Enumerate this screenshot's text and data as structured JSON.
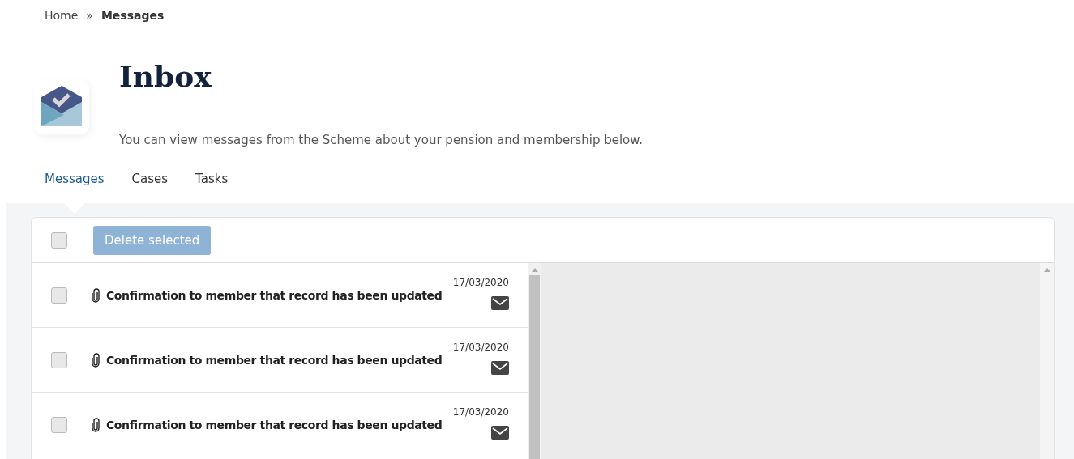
{
  "breadcrumb": [
    {
      "label": "Home",
      "current": false
    },
    {
      "label": "»",
      "current": false
    },
    {
      "label": "Messages",
      "current": true
    }
  ],
  "header": {
    "title": "Inbox",
    "description": "You can view messages from the Scheme about your pension and membership below."
  },
  "tabs": [
    {
      "label": "Messages",
      "selected": true
    },
    {
      "label": "Cases",
      "selected": false
    },
    {
      "label": "Tasks",
      "selected": false
    }
  ],
  "toolbar": {
    "select_all": {
      "checked": false
    },
    "delete_button": {
      "label": "Delete selected",
      "disabled": true
    }
  },
  "messages": [
    {
      "date": "17/03/2020",
      "subject": "Confirmation to member that record has been updated",
      "checked": false,
      "attachment": true
    },
    {
      "date": "17/03/2020",
      "subject": "Confirmation to member that record has been updated",
      "checked": false,
      "attachment": true
    },
    {
      "date": "17/03/2020",
      "subject": "Confirmation to member that record has been updated",
      "checked": false,
      "attachment": true
    }
  ]
}
